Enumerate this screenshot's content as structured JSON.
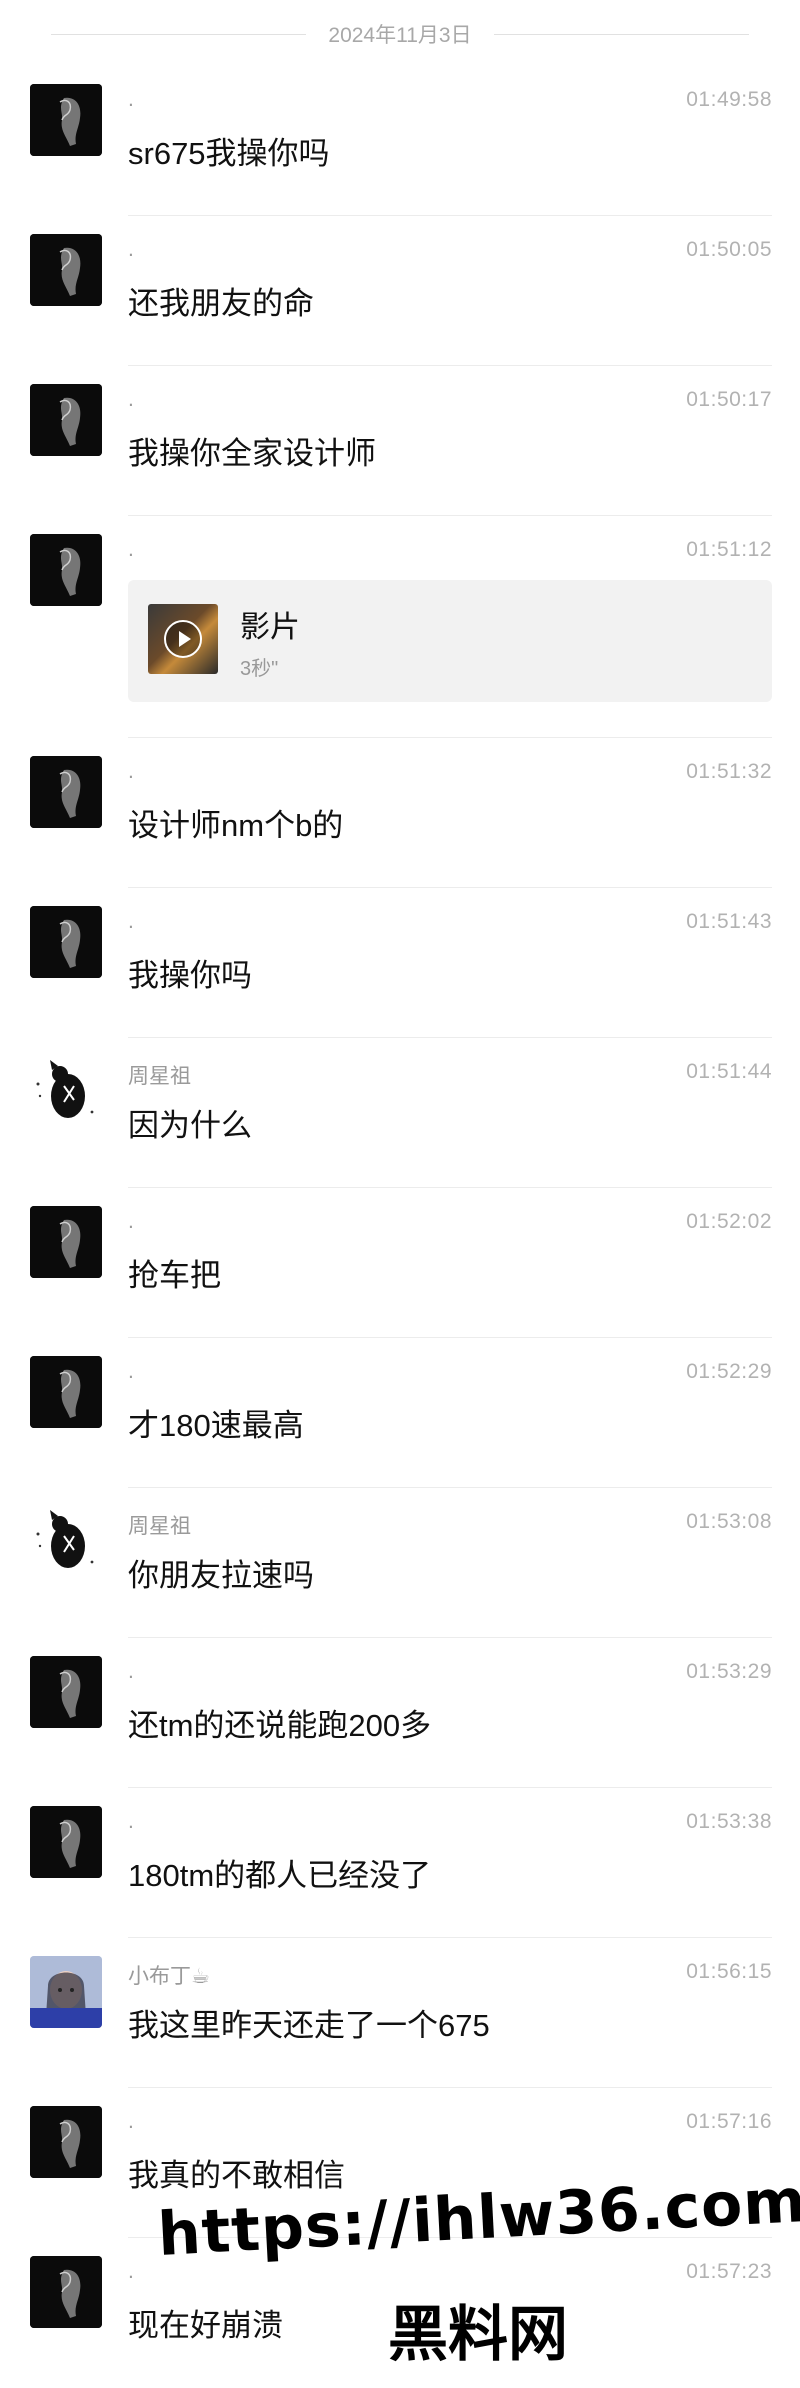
{
  "chat": {
    "date": "2024年11月3日",
    "messages": [
      {
        "sender": ".",
        "time": "01:49:58",
        "text": "sr675我操你吗",
        "avatar": "dark-avatar"
      },
      {
        "sender": ".",
        "time": "01:50:05",
        "text": "还我朋友的命",
        "avatar": "dark-avatar"
      },
      {
        "sender": ".",
        "time": "01:50:17",
        "text": "我操你全家设计师",
        "avatar": "dark-avatar"
      },
      {
        "sender": ".",
        "time": "01:51:12",
        "video": {
          "title": "影片",
          "duration": "3秒\""
        },
        "avatar": "dark-avatar"
      },
      {
        "sender": ".",
        "time": "01:51:32",
        "text": "设计师nm个b的",
        "avatar": "dark-avatar"
      },
      {
        "sender": ".",
        "time": "01:51:43",
        "text": "我操你吗",
        "avatar": "dark-avatar"
      },
      {
        "sender": "周星祖",
        "time": "01:51:44",
        "text": "因为什么",
        "avatar": "cat-avatar"
      },
      {
        "sender": ".",
        "time": "01:52:02",
        "text": "抢车把",
        "avatar": "dark-avatar"
      },
      {
        "sender": ".",
        "time": "01:52:29",
        "text": "才180速最高",
        "avatar": "dark-avatar"
      },
      {
        "sender": "周星祖",
        "time": "01:53:08",
        "text": "你朋友拉速吗",
        "avatar": "cat-avatar"
      },
      {
        "sender": ".",
        "time": "01:53:29",
        "text": "还tm的还说能跑200多",
        "avatar": "dark-avatar"
      },
      {
        "sender": ".",
        "time": "01:53:38",
        "text": "180tm的都人已经没了",
        "avatar": "dark-avatar"
      },
      {
        "sender": "小布丁☕",
        "time": "01:56:15",
        "text": "我这里昨天还走了一个675",
        "avatar": "girl-avatar"
      },
      {
        "sender": ".",
        "time": "01:57:16",
        "text": "我真的不敢相信",
        "avatar": "dark-avatar"
      },
      {
        "sender": ".",
        "time": "01:57:23",
        "text": "现在好崩溃",
        "avatar": "dark-avatar"
      }
    ]
  },
  "watermark": {
    "url": "https://ihlw36.com",
    "name": "黑料网"
  }
}
